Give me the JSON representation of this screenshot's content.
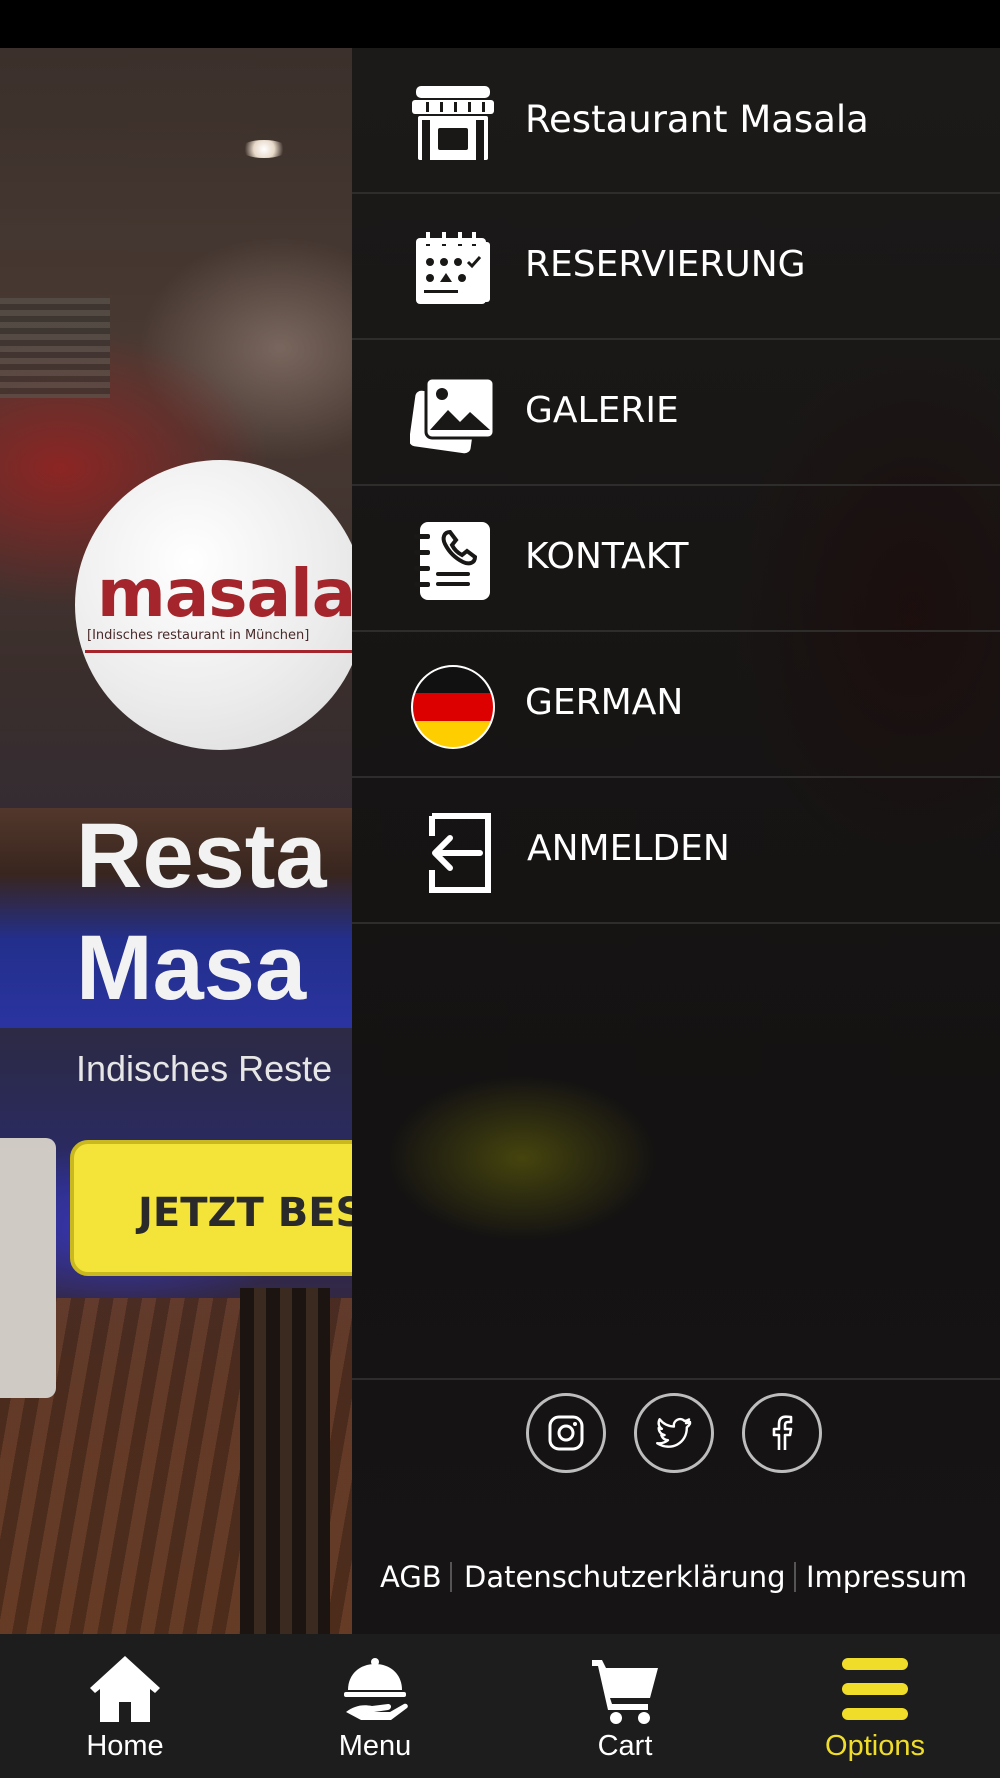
{
  "home": {
    "logo_text": "masala",
    "logo_subtitle": "[Indisches restaurant in München]",
    "hero_title_line1": "Resta",
    "hero_title_line2": "Masa",
    "hero_subtitle": "Indisches Reste",
    "order_button_label": "JETZT BEST"
  },
  "drawer": {
    "items": [
      {
        "label": "Restaurant Masala",
        "icon": "store-icon"
      },
      {
        "label": "RESERVIERUNG",
        "icon": "calendar-icon"
      },
      {
        "label": "GALERIE",
        "icon": "gallery-icon"
      },
      {
        "label": "KONTAKT",
        "icon": "contact-book-icon"
      },
      {
        "label": "GERMAN",
        "icon": "german-flag-icon"
      },
      {
        "label": "ANMELDEN",
        "icon": "login-icon"
      }
    ],
    "social": [
      "instagram-icon",
      "twitter-icon",
      "facebook-icon"
    ],
    "legal": {
      "agb": "AGB",
      "privacy": "Datenschutzerklärung",
      "imprint": "Impressum"
    }
  },
  "bottom_nav": {
    "items": [
      {
        "label": "Home",
        "icon": "home-icon"
      },
      {
        "label": "Menu",
        "icon": "cloche-icon"
      },
      {
        "label": "Cart",
        "icon": "cart-icon"
      },
      {
        "label": "Options",
        "icon": "hamburger-icon",
        "active": true
      }
    ]
  },
  "colors": {
    "accent_yellow": "#f0dd2a",
    "button_yellow": "#f4e43a",
    "drawer_bg": "#181615",
    "nav_bg": "#1d1d1d",
    "logo_red": "#a4262c"
  }
}
